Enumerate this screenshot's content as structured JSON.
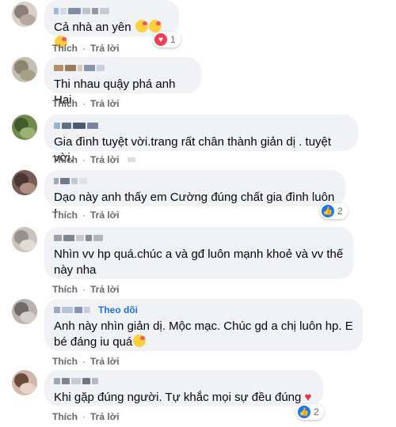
{
  "comments": [
    {
      "author": "",
      "text": "Cả nhà an yên",
      "emoji": "🥰🥰🥰",
      "reaction": {
        "type": "heart",
        "count": "1"
      },
      "actions": {
        "like": "Thích",
        "reply": "Trả lời"
      }
    },
    {
      "author": "",
      "text": "Thi nhau quậy phá anh Hai",
      "actions": {
        "like": "Thích",
        "reply": "Trả lời"
      }
    },
    {
      "author": "",
      "text": "Gia đình tuyệt vời.trang rất chân thành giản dị . tuyệt vời.",
      "actions": {
        "like": "Thích",
        "reply": "Trả lời"
      }
    },
    {
      "author": "",
      "text": "Dạo này anh thấy em Cường đúng chất gia đình luôn !",
      "reaction": {
        "type": "like",
        "count": "2"
      },
      "actions": {
        "like": "Thích",
        "reply": "Trả lời"
      }
    },
    {
      "author": "",
      "text": "Nhìn vv hp quá.chúc a và gđ luôn mạnh khoẻ và vv thế này nha",
      "actions": {
        "like": "Thích",
        "reply": "Trả lời"
      }
    },
    {
      "author": "",
      "follow": "Theo dõi",
      "text": "Anh này nhìn giản dị. Mộc mạc. Chúc gd a chị luôn hp. E bé đáng iu quá",
      "emoji": "🥰",
      "actions": {
        "like": "Thích",
        "reply": "Trả lời"
      }
    },
    {
      "author": "",
      "text": "Khi gặp đúng người. Tự khắc mọi sự đều đúng",
      "emoji": "❤️",
      "reaction": {
        "type": "like",
        "count": "2"
      },
      "actions": {
        "like": "Thích",
        "reply": "Trả lời"
      }
    }
  ],
  "colors": {
    "bubble": "#f0f2f5",
    "text": "#050505",
    "meta": "#65676b",
    "link": "#216fdb",
    "like": "#1877f2",
    "heart": "#f33e58"
  }
}
